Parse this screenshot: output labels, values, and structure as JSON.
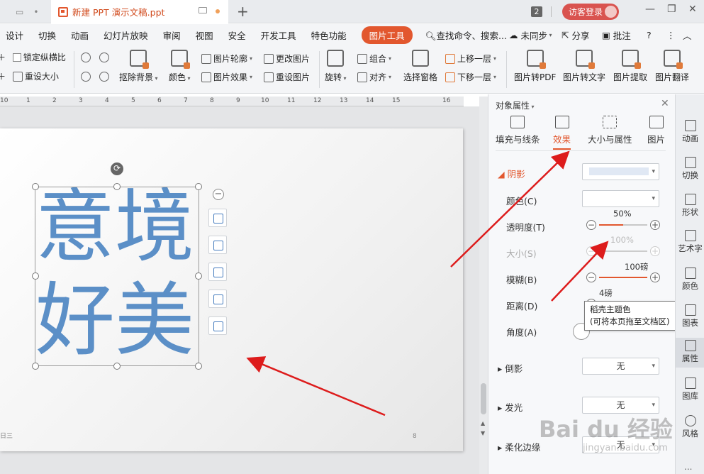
{
  "titlebar": {
    "doc_title": "新建 PPT 演示文稿.ppt",
    "new_tab": "+",
    "window_count": "2",
    "visitor_login": "访客登录",
    "minimize": "—",
    "restore": "❐",
    "close": "✕"
  },
  "menubar": {
    "items": [
      "设计",
      "切换",
      "动画",
      "幻灯片放映",
      "审阅",
      "视图",
      "安全",
      "开发工具",
      "特色功能"
    ],
    "active": "图片工具",
    "search": "查找命令、搜索...",
    "sync": "未同步",
    "share": "分享",
    "comment": "批注",
    "help": "?"
  },
  "ribbon": {
    "lock_ratio": "锁定纵横比",
    "reset_size": "重设大小",
    "remove_bg": "抠除背景",
    "color": "颜色",
    "outline": "图片轮廓",
    "effect": "图片效果",
    "change_pic": "更改图片",
    "reset_pic": "重设图片",
    "rotate": "旋转",
    "group": "组合",
    "align": "对齐",
    "selection_pane": "选择窗格",
    "bring_forward": "上移一层",
    "send_backward": "下移一层",
    "to_pdf": "图片转PDF",
    "to_text": "图片转文字",
    "extract": "图片提取",
    "translate": "图片翻译"
  },
  "ruler": {
    "ticks": [
      "10",
      "1",
      "2",
      "3",
      "4",
      "5",
      "6",
      "7",
      "8",
      "9",
      "10",
      "11",
      "12",
      "13",
      "14",
      "15",
      "16"
    ]
  },
  "slide": {
    "line1": "意境",
    "line2": "好美",
    "footer_left": "日三",
    "page_num": "8",
    "text_colors": {
      "dark": "#5b8fc7",
      "light": "#a9c3e0"
    }
  },
  "panel": {
    "title": "对象属性",
    "tabs": [
      "填充与线条",
      "效果",
      "大小与属性",
      "图片"
    ],
    "active_tab": "效果",
    "shadow": "阴影",
    "color_label": "颜色(C)",
    "transparency_label": "透明度(T)",
    "transparency_value": "50%",
    "transparency_fraction": 0.5,
    "size_label": "大小(S)",
    "size_value": "100%",
    "size_fraction": 1.0,
    "blur_label": "模糊(B)",
    "blur_value": "100磅",
    "blur_fraction": 1.0,
    "distance_label": "距离(D)",
    "distance_value": "4磅",
    "angle_label": "角度(A)",
    "reflection": "倒影",
    "reflection_value": "无",
    "glow": "发光",
    "glow_value": "无",
    "soft_edge": "柔化边缘",
    "soft_edge_value": "无",
    "tooltip_line1": "稻壳主题色",
    "tooltip_line2": "(可将本页拖至文档区)"
  },
  "sidebar": {
    "items": [
      "动画",
      "切换",
      "形状",
      "艺术字",
      "颜色",
      "图表",
      "属性",
      "图库",
      "风格"
    ],
    "more": "..."
  },
  "watermark": {
    "main": "Bai du 经验",
    "sub": "jingyan.baidu.com"
  },
  "colors": {
    "accent": "#e2572e",
    "arrow": "#dd1c1c"
  }
}
